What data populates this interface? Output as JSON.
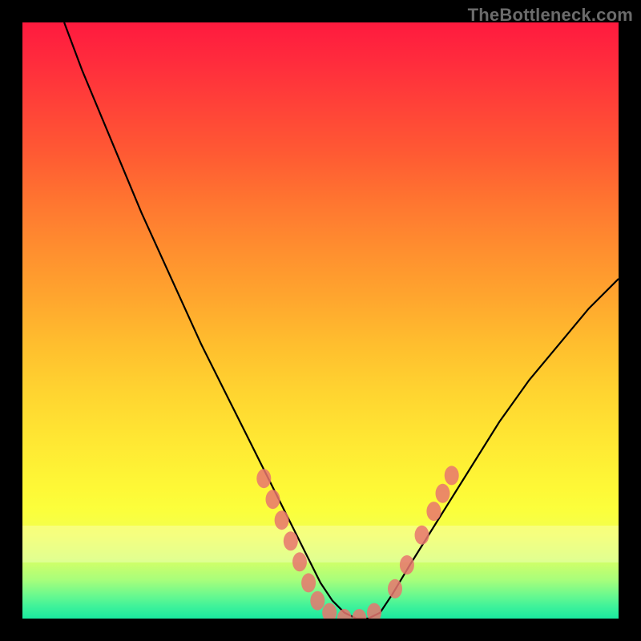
{
  "watermark": "TheBottleneck.com",
  "chart_data": {
    "type": "line",
    "title": "",
    "xlabel": "",
    "ylabel": "",
    "xlim": [
      0,
      100
    ],
    "ylim": [
      0,
      100
    ],
    "grid": false,
    "legend": false,
    "series": [
      {
        "name": "curve",
        "x": [
          7,
          10,
          15,
          20,
          25,
          30,
          35,
          38,
          40,
          42,
          44,
          46,
          48,
          50,
          52,
          54,
          56,
          58,
          60,
          62,
          65,
          70,
          75,
          80,
          85,
          90,
          95,
          100
        ],
        "y": [
          100,
          92,
          80,
          68,
          57,
          46,
          36,
          30,
          26,
          22,
          18,
          14,
          10,
          6,
          3,
          1,
          0,
          0,
          1,
          4,
          9,
          17,
          25,
          33,
          40,
          46,
          52,
          57
        ]
      }
    ],
    "markers": [
      {
        "x": 40.5,
        "y": 23.5
      },
      {
        "x": 42.0,
        "y": 20.0
      },
      {
        "x": 43.5,
        "y": 16.5
      },
      {
        "x": 45.0,
        "y": 13.0
      },
      {
        "x": 46.5,
        "y": 9.5
      },
      {
        "x": 48.0,
        "y": 6.0
      },
      {
        "x": 49.5,
        "y": 3.0
      },
      {
        "x": 51.5,
        "y": 1.0
      },
      {
        "x": 54.0,
        "y": 0.0
      },
      {
        "x": 56.5,
        "y": 0.0
      },
      {
        "x": 59.0,
        "y": 1.0
      },
      {
        "x": 62.5,
        "y": 5.0
      },
      {
        "x": 64.5,
        "y": 9.0
      },
      {
        "x": 67.0,
        "y": 14.0
      },
      {
        "x": 69.0,
        "y": 18.0
      },
      {
        "x": 70.5,
        "y": 21.0
      },
      {
        "x": 72.0,
        "y": 24.0
      }
    ],
    "colors": {
      "curve": "#000000",
      "marker_fill": "#e8766f",
      "marker_stroke": "#e8766f"
    }
  }
}
